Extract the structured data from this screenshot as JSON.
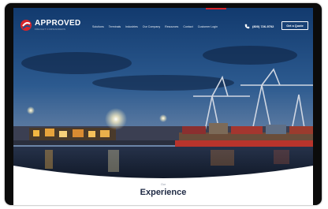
{
  "header": {
    "logo_name": "APPROVED",
    "logo_tagline": "FREIGHT FORWARDERS",
    "nav": [
      "Solutions",
      "Terminals",
      "Industries",
      "Our Company",
      "Resources",
      "Contact",
      "Customer Login"
    ],
    "phone": "(800) 726-9702",
    "quote_button": "Get a Quote"
  },
  "section": {
    "label": "Our",
    "title": "Experience"
  },
  "colors": {
    "brand_red": "#d6242b",
    "title_navy": "#1f2a44"
  },
  "icons": [
    "logo-mark",
    "phone-icon"
  ]
}
